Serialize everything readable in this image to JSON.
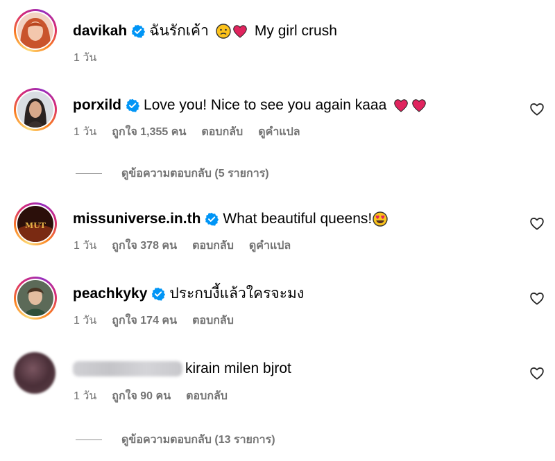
{
  "comments": [
    {
      "username": "davikah",
      "text": "ฉันรักเค้า",
      "text_after": "My girl crush",
      "emojis": [
        "confused-face",
        "red-heart"
      ],
      "time": "1 วัน",
      "likes": "",
      "reply": "",
      "translate": ""
    },
    {
      "username": "porxild",
      "text": "Love you! Nice to see you again kaaa",
      "emojis": [
        "red-heart",
        "red-heart"
      ],
      "time": "1 วัน",
      "likes": "ถูกใจ 1,355 คน",
      "reply": "ตอบกลับ",
      "translate": "ดูคำแปล",
      "view_replies": "ดูข้อความตอบกลับ (5 รายการ)"
    },
    {
      "username": "missuniverse.in.th",
      "text": "What beautiful queens!",
      "emojis": [
        "heart-eyes-face"
      ],
      "time": "1 วัน",
      "likes": "ถูกใจ 378 คน",
      "reply": "ตอบกลับ",
      "translate": "ดูคำแปล",
      "avatar_text": "MUT"
    },
    {
      "username": "peachkyky",
      "text": "ประกบงี้แล้วใครจะมง",
      "emojis": [],
      "time": "1 วัน",
      "likes": "ถูกใจ 174 คน",
      "reply": "ตอบกลับ"
    },
    {
      "username": "",
      "text": "kirain milen bjrot",
      "emojis": [],
      "time": "1 วัน",
      "likes": "ถูกใจ 90 คน",
      "reply": "ตอบกลับ",
      "view_replies": "ดูข้อความตอบกลับ (13 รายการ)"
    }
  ],
  "colors": {
    "meta_gray": "#737373",
    "verified_blue": "#0095f6",
    "heart_red": "#e0245e"
  }
}
